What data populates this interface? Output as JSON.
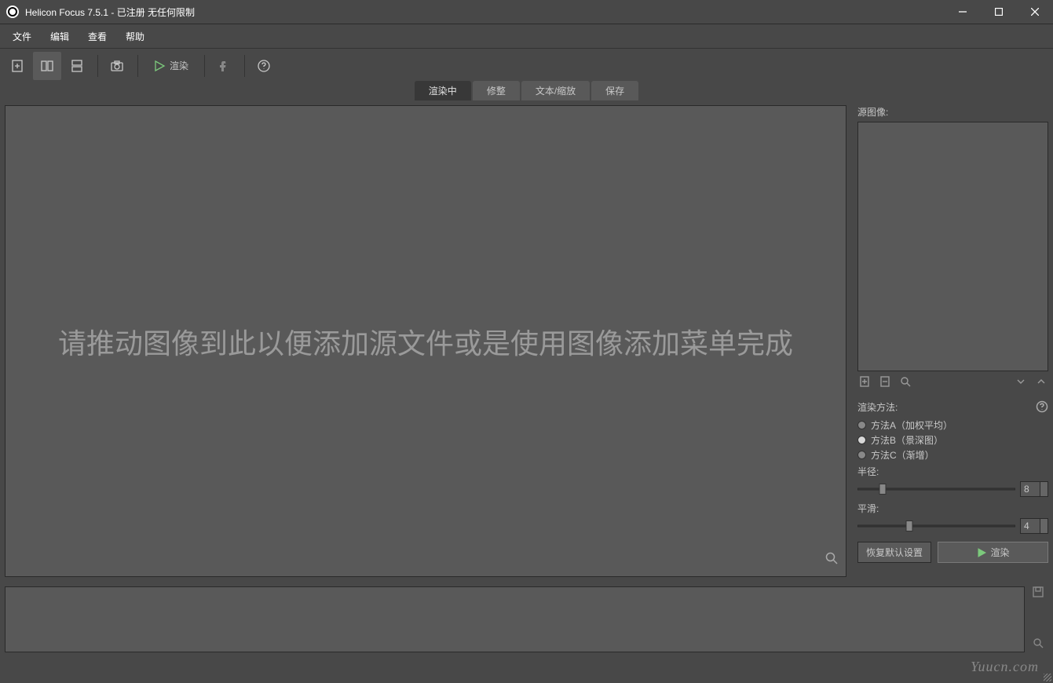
{
  "titlebar": {
    "title": "Helicon Focus 7.5.1 - 已注册  无任何限制"
  },
  "menu": {
    "file": "文件",
    "edit": "编辑",
    "view": "查看",
    "help": "帮助"
  },
  "toolbar": {
    "render_label": "渲染"
  },
  "tabs": {
    "rendering": "渲染中",
    "retouch": "修整",
    "textscale": "文本/缩放",
    "save": "保存"
  },
  "canvas": {
    "prompt": "请推动图像到此以便添加源文件或是使用图像添加菜单完成"
  },
  "panel": {
    "source_label": "源图像:",
    "method_label": "渲染方法:",
    "method_a": "方法A（加权平均）",
    "method_b": "方法B（景深图）",
    "method_c": "方法C（渐增）",
    "selected_method": "b",
    "radius_label": "半径:",
    "radius_value": "8",
    "radius_percent": 16,
    "smooth_label": "平滑:",
    "smooth_value": "4",
    "smooth_percent": 33,
    "reset_label": "恢复默认设置",
    "render_label": "渲染"
  },
  "watermark": "Yuucn.com"
}
